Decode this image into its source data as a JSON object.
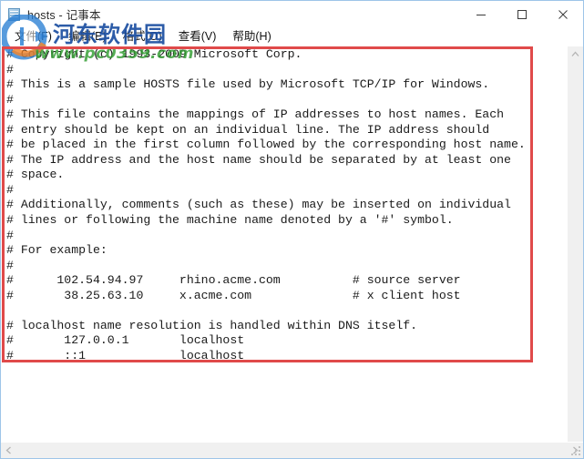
{
  "window": {
    "title": "hosts - 记事本",
    "icon": "notepad-icon",
    "controls": {
      "minimize": "最小化",
      "maximize": "最大化",
      "close": "关闭"
    }
  },
  "menubar": {
    "items": [
      {
        "label": "文件(F)",
        "name": "menu-file"
      },
      {
        "label": "编辑(E)",
        "name": "menu-edit"
      },
      {
        "label": "格式(O)",
        "name": "menu-format"
      },
      {
        "label": "查看(V)",
        "name": "menu-view"
      },
      {
        "label": "帮助(H)",
        "name": "menu-help"
      }
    ]
  },
  "editor": {
    "content": "# Copyright (c) 1993-2009 Microsoft Corp.\n#\n# This is a sample HOSTS file used by Microsoft TCP/IP for Windows.\n#\n# This file contains the mappings of IP addresses to host names. Each\n# entry should be kept on an individual line. The IP address should\n# be placed in the first column followed by the corresponding host name.\n# The IP address and the host name should be separated by at least one\n# space.\n#\n# Additionally, comments (such as these) may be inserted on individual\n# lines or following the machine name denoted by a '#' symbol.\n#\n# For example:\n#\n#      102.54.94.97     rhino.acme.com          # source server\n#       38.25.63.10     x.acme.com              # x client host\n\n# localhost name resolution is handled within DNS itself.\n#       127.0.0.1       localhost\n#       ::1             localhost",
    "lines": [
      "# Copyright (c) 1993-2009 Microsoft Corp.",
      "#",
      "# This is a sample HOSTS file used by Microsoft TCP/IP for Windows.",
      "#",
      "# This file contains the mappings of IP addresses to host names. Each",
      "# entry should be kept on an individual line. The IP address should",
      "# be placed in the first column followed by the corresponding host name.",
      "# The IP address and the host name should be separated by at least one",
      "# space.",
      "#",
      "# Additionally, comments (such as these) may be inserted on individual",
      "# lines or following the machine name denoted by a '#' symbol.",
      "#",
      "# For example:",
      "#",
      "#      102.54.94.97     rhino.acme.com          # source server",
      "#       38.25.63.10     x.acme.com              # x client host",
      "",
      "# localhost name resolution is handled within DNS itself.",
      "#       127.0.0.1       localhost",
      "#       ::1             localhost"
    ],
    "host_entries": [
      {
        "ip": "102.54.94.97",
        "host": "rhino.acme.com",
        "comment": "# source server"
      },
      {
        "ip": "38.25.63.10",
        "host": "x.acme.com",
        "comment": "# x client host"
      },
      {
        "ip": "127.0.0.1",
        "host": "localhost",
        "comment": ""
      },
      {
        "ip": "::1",
        "host": "localhost",
        "comment": ""
      }
    ]
  },
  "annotation": {
    "shape": "rectangle",
    "color": "#e04a4a"
  },
  "watermark": {
    "site_name": "河东软件园",
    "url": "www.pc0359.com",
    "name_color": "#1c4fa1",
    "url_color": "#2f9b2f"
  },
  "scrollbars": {
    "vertical_up": "▲",
    "vertical_down": "▼",
    "horizontal_left": "◀",
    "horizontal_right": "▶"
  }
}
